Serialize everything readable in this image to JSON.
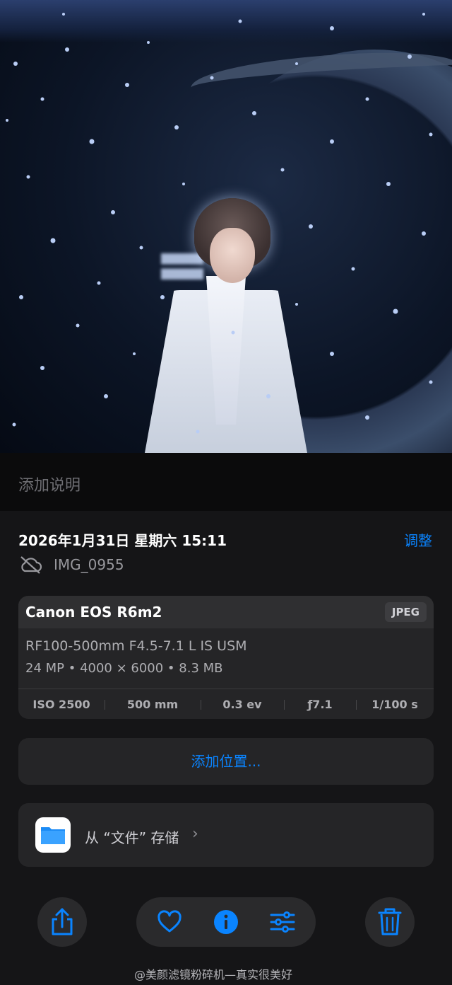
{
  "caption": {
    "placeholder": "添加说明"
  },
  "info": {
    "date": "2026年1月31日 星期六 15:11",
    "adjust_label": "调整",
    "filename": "IMG_0955"
  },
  "camera": {
    "model": "Canon EOS R6m2",
    "format": "JPEG",
    "lens": "RF100-500mm F4.5-7.1 L IS USM",
    "specs": "24 MP • 4000 × 6000 • 8.3 MB",
    "exif": [
      "ISO 2500",
      "500 mm",
      "0.3 ev",
      "ƒ7.1",
      "1/100 s"
    ]
  },
  "location": {
    "label": "添加位置..."
  },
  "files": {
    "label": "从 “文件” 存储",
    "chevron": "›"
  },
  "toolbar": {
    "icons": [
      "share-icon",
      "heart-icon",
      "info-icon",
      "adjust-sliders-icon",
      "trash-icon"
    ]
  },
  "watermark": "@美颜滤镜粉碎机—真实很美好",
  "colors": {
    "accent": "#0a84ff",
    "background": "#151517",
    "card": "#252527"
  }
}
